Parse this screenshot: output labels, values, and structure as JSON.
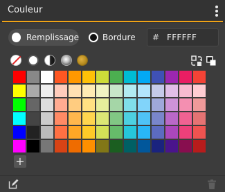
{
  "panel": {
    "title": "Couleur"
  },
  "fill": {
    "label": "Remplissage"
  },
  "stroke": {
    "label": "Bordure"
  },
  "hex": {
    "prefix": "#",
    "value": "FFFFFF"
  },
  "icons": {
    "menu": "vertical-dots-icon",
    "swap": "swap-colors-icon",
    "default": "default-colors-icon",
    "add": "plus-icon",
    "edit": "edit-icon",
    "delete": "trash-icon"
  },
  "add_label": "+",
  "palette": [
    "#ff0000",
    "#888888",
    "#ffffff",
    "#ff5722",
    "#ff9800",
    "#ffc107",
    "#cddc39",
    "#4caf50",
    "#00bcd4",
    "#03a9f4",
    "#3f51b5",
    "#9c27b0",
    "#e91e63",
    "#f44336",
    "#ffff00",
    "#aaaaaa",
    "#eeeeee",
    "#ffccbc",
    "#ffe0b2",
    "#ffecb3",
    "#f0f4c3",
    "#c8e6c9",
    "#b2ebf2",
    "#b3e5fc",
    "#c5cae9",
    "#e1bee7",
    "#f8bbd0",
    "#ffcdd2",
    "#00ff00",
    "#666666",
    "#dddddd",
    "#ffab91",
    "#ffcc80",
    "#ffe082",
    "#e6ee9c",
    "#a5d6a7",
    "#80deea",
    "#81d4fa",
    "#9fa8da",
    "#ce93d8",
    "#f48fb1",
    "#ef9a9a",
    "#00ffff",
    "#444444",
    "#cccccc",
    "#ff8a65",
    "#ffb74d",
    "#ffd54f",
    "#dce775",
    "#81c784",
    "#4dd0e1",
    "#4fc3f7",
    "#7986cb",
    "#ba68c8",
    "#f06292",
    "#e57373",
    "#0000ff",
    "#222222",
    "#bbbbbb",
    "#ff7043",
    "#ffa726",
    "#ffca28",
    "#d4e157",
    "#66bb6a",
    "#26c6da",
    "#29b6f6",
    "#5c6bc0",
    "#ab47bc",
    "#ec407a",
    "#ef5350",
    "#ff00ff",
    "#000000",
    "#777777",
    "#d84315",
    "#ef6c00",
    "#ff8f00",
    "#827717",
    "#1b5e20",
    "#006064",
    "#01579b",
    "#1a237e",
    "#4a148c",
    "#880e4f",
    "#b71c1c"
  ]
}
